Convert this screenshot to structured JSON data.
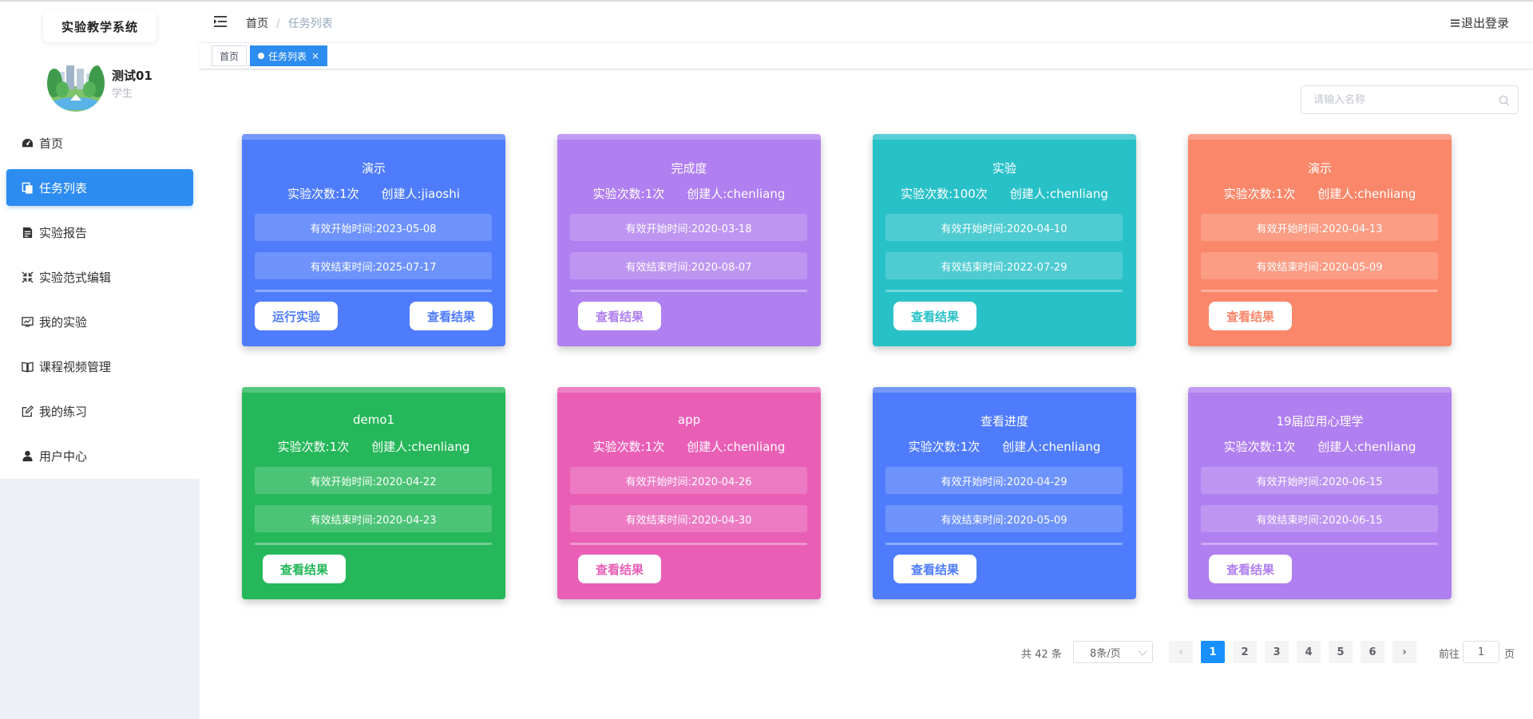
{
  "sidebar": {
    "brand": "实验教学系统",
    "user": {
      "name": "测试01",
      "role": "学生"
    },
    "items": [
      {
        "label": "首页",
        "icon": "dashboard-icon"
      },
      {
        "label": "任务列表",
        "icon": "copy-icon",
        "active": true
      },
      {
        "label": "实验报告",
        "icon": "document-icon"
      },
      {
        "label": "实验范式编辑",
        "icon": "compress-icon"
      },
      {
        "label": "我的实验",
        "icon": "monitor-chart-icon"
      },
      {
        "label": "课程视频管理",
        "icon": "book-icon"
      },
      {
        "label": "我的练习",
        "icon": "edit-icon"
      },
      {
        "label": "用户中心",
        "icon": "user-icon"
      }
    ]
  },
  "header": {
    "breadcrumb": [
      "首页",
      "任务列表"
    ],
    "separator": "/",
    "logout": "退出登录"
  },
  "tags": [
    {
      "label": "首页"
    },
    {
      "label": "任务列表",
      "active": true,
      "close": "×"
    }
  ],
  "search": {
    "placeholder": "请输入名称",
    "value": ""
  },
  "cards": [
    {
      "title": "演示",
      "count": "实验次数:1次",
      "creator": "创建人:jiaoshi",
      "start": "有效开始时间:2023-05-08",
      "end": "有效结束时间:2025-07-17",
      "color": "#4f7cfc",
      "run_label": "运行实验",
      "result_label": "查看结果"
    },
    {
      "title": "完成度",
      "count": "实验次数:1次",
      "creator": "创建人:chenliang",
      "start": "有效开始时间:2020-03-18",
      "end": "有效结束时间:2020-08-07",
      "color": "#b07ff0",
      "result_label": "查看结果"
    },
    {
      "title": "实验",
      "count": "实验次数:100次",
      "creator": "创建人:chenliang",
      "start": "有效开始时间:2020-04-10",
      "end": "有效结束时间:2022-07-29",
      "color": "#29c1c8",
      "result_label": "查看结果"
    },
    {
      "title": "演示",
      "count": "实验次数:1次",
      "creator": "创建人:chenliang",
      "start": "有效开始时间:2020-04-13",
      "end": "有效结束时间:2020-05-09",
      "color": "#fa876a",
      "result_label": "查看结果"
    },
    {
      "title": "demo1",
      "count": "实验次数:1次",
      "creator": "创建人:chenliang",
      "start": "有效开始时间:2020-04-22",
      "end": "有效结束时间:2020-04-23",
      "color": "#25b75a",
      "result_label": "查看结果"
    },
    {
      "title": "app",
      "count": "实验次数:1次",
      "creator": "创建人:chenliang",
      "start": "有效开始时间:2020-04-26",
      "end": "有效结束时间:2020-04-30",
      "color": "#e95fb6",
      "result_label": "查看结果"
    },
    {
      "title": "查看进度",
      "count": "实验次数:1次",
      "creator": "创建人:chenliang",
      "start": "有效开始时间:2020-04-29",
      "end": "有效结束时间:2020-05-09",
      "color": "#4f7cfc",
      "result_label": "查看结果"
    },
    {
      "title": "19届应用心理学",
      "count": "实验次数:1次",
      "creator": "创建人:chenliang",
      "start": "有效开始时间:2020-06-15",
      "end": "有效结束时间:2020-06-15",
      "color": "#b07ff0",
      "result_label": "查看结果"
    }
  ],
  "pagination": {
    "total": "共 42 条",
    "page_size": "8条/页",
    "pages": [
      "1",
      "2",
      "3",
      "4",
      "5",
      "6"
    ],
    "current": "1",
    "prev": "‹",
    "next": "›",
    "goto_prefix": "前往",
    "goto_value": "1",
    "goto_suffix": "页"
  }
}
